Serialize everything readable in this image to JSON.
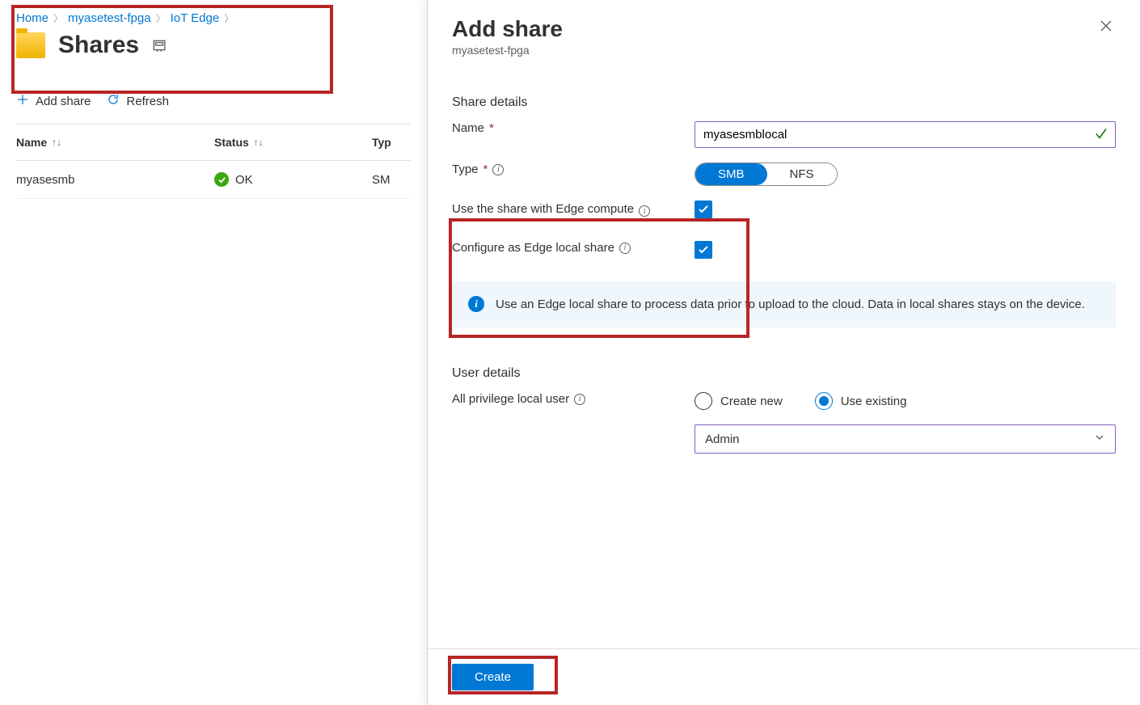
{
  "breadcrumb": {
    "home": "Home",
    "device": "myasetest-fpga",
    "page": "IoT Edge"
  },
  "page_title": "Shares",
  "toolbar": {
    "add": "Add share",
    "refresh": "Refresh"
  },
  "table": {
    "headers": {
      "name": "Name",
      "status": "Status",
      "type": "Typ"
    },
    "rows": [
      {
        "name": "myasesmb",
        "status": "OK",
        "type": "SM"
      }
    ]
  },
  "panel": {
    "title": "Add share",
    "subtitle": "myasetest-fpga",
    "share_details": "Share details",
    "name_label": "Name",
    "name_value": "myasesmblocal",
    "type_label": "Type",
    "type_options": {
      "smb": "SMB",
      "nfs": "NFS"
    },
    "edge_compute_label": "Use the share with Edge compute",
    "edge_local_label": "Configure as Edge local share",
    "info_text": "Use an Edge local share to process data prior to upload to the cloud. Data in local shares stays on the device.",
    "user_details": "User details",
    "user_label": "All privilege local user",
    "radio_new": "Create new",
    "radio_existing": "Use existing",
    "dropdown_value": "Admin",
    "create_button": "Create"
  }
}
